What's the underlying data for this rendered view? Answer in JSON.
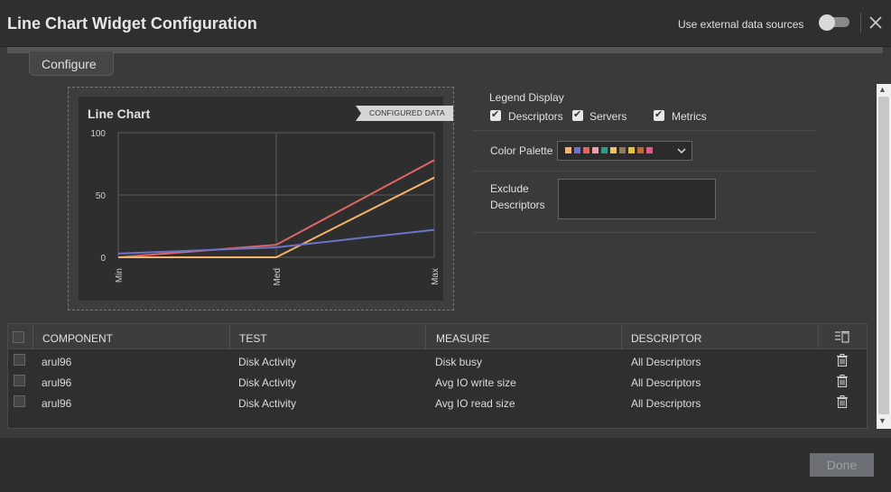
{
  "header": {
    "title": "Line Chart Widget Configuration",
    "external_label": "Use external data sources",
    "external_enabled": false
  },
  "tabs": [
    {
      "label": "Configure",
      "active": true
    }
  ],
  "preview": {
    "title": "Line Chart",
    "badge": "CONFIGURED DATA"
  },
  "chart_data": {
    "type": "line",
    "categories": [
      "Min",
      "Med",
      "Max"
    ],
    "ylim": [
      0,
      100
    ],
    "yticks": [
      "100",
      "50",
      "0"
    ],
    "grid": true,
    "series": [
      {
        "color": "#e06666",
        "values": [
          0,
          10,
          78
        ]
      },
      {
        "color": "#f6b26b",
        "values": [
          0,
          0,
          64
        ]
      },
      {
        "color": "#6b74c9",
        "values": [
          3,
          8,
          22
        ]
      }
    ]
  },
  "config": {
    "legend_label": "Legend Display",
    "legend_options": [
      {
        "label": "Descriptors",
        "checked": true
      },
      {
        "label": "Servers",
        "checked": true
      },
      {
        "label": "Metrics",
        "checked": true
      }
    ],
    "palette_label": "Color Palette",
    "palette_colors": [
      "#f6b26b",
      "#6b74c9",
      "#e06666",
      "#e8a0b0",
      "#2a9d8f",
      "#e9c46a",
      "#8d7b5a",
      "#e0c341",
      "#c06a3a",
      "#e05a8a"
    ],
    "exclude_label_line1": "Exclude",
    "exclude_label_line2": "Descriptors",
    "exclude_value": ""
  },
  "table": {
    "columns": [
      "COMPONENT",
      "TEST",
      "MEASURE",
      "DESCRIPTOR"
    ],
    "rows": [
      {
        "component": "arul96",
        "test": "Disk Activity",
        "measure": "Disk busy",
        "descriptor": "All Descriptors"
      },
      {
        "component": "arul96",
        "test": "Disk Activity",
        "measure": "Avg IO write size",
        "descriptor": "All Descriptors"
      },
      {
        "component": "arul96",
        "test": "Disk Activity",
        "measure": "Avg IO read size",
        "descriptor": "All Descriptors"
      }
    ]
  },
  "footer": {
    "done_label": "Done"
  }
}
